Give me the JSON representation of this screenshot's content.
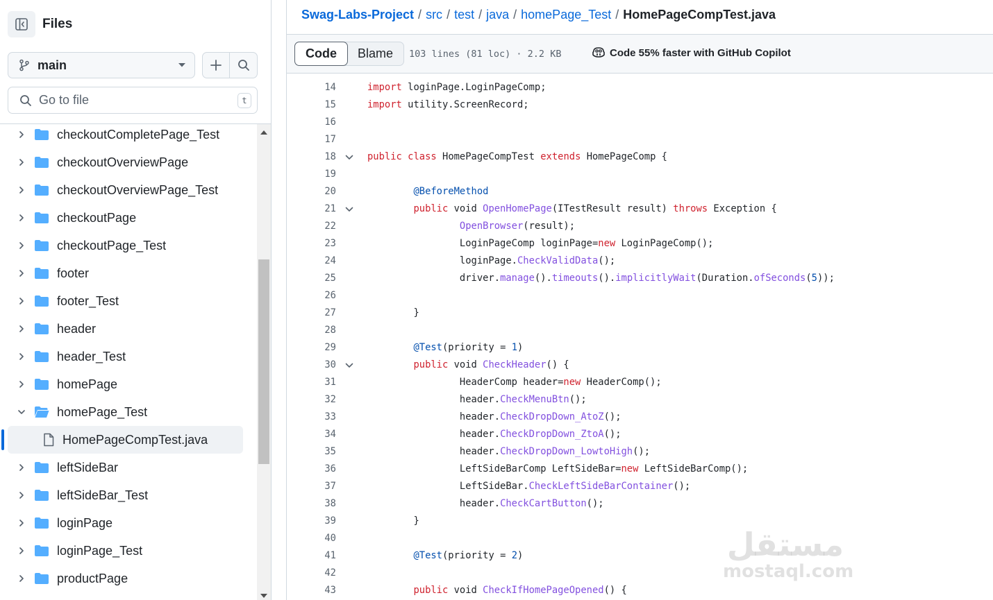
{
  "sidebar": {
    "title": "Files",
    "branch": "main",
    "goto_placeholder": "Go to file",
    "goto_shortcut": "t",
    "tree": [
      {
        "name": "checkoutCompletePage_Test",
        "type": "folder",
        "expanded": false
      },
      {
        "name": "checkoutOverviewPage",
        "type": "folder",
        "expanded": false
      },
      {
        "name": "checkoutOverviewPage_Test",
        "type": "folder",
        "expanded": false
      },
      {
        "name": "checkoutPage",
        "type": "folder",
        "expanded": false
      },
      {
        "name": "checkoutPage_Test",
        "type": "folder",
        "expanded": false
      },
      {
        "name": "footer",
        "type": "folder",
        "expanded": false
      },
      {
        "name": "footer_Test",
        "type": "folder",
        "expanded": false
      },
      {
        "name": "header",
        "type": "folder",
        "expanded": false
      },
      {
        "name": "header_Test",
        "type": "folder",
        "expanded": false
      },
      {
        "name": "homePage",
        "type": "folder",
        "expanded": false
      },
      {
        "name": "homePage_Test",
        "type": "folder",
        "expanded": true
      },
      {
        "name": "HomePageCompTest.java",
        "type": "file",
        "selected": true
      },
      {
        "name": "leftSideBar",
        "type": "folder",
        "expanded": false
      },
      {
        "name": "leftSideBar_Test",
        "type": "folder",
        "expanded": false
      },
      {
        "name": "loginPage",
        "type": "folder",
        "expanded": false
      },
      {
        "name": "loginPage_Test",
        "type": "folder",
        "expanded": false
      },
      {
        "name": "productPage",
        "type": "folder",
        "expanded": false
      }
    ]
  },
  "breadcrumb": {
    "repo": "Swag-Labs-Project",
    "parts": [
      "src",
      "test",
      "java",
      "homePage_Test"
    ],
    "current": "HomePageCompTest.java"
  },
  "toolbar": {
    "code_tab": "Code",
    "blame_tab": "Blame",
    "file_info": "103 lines (81 loc) · 2.2 KB",
    "copilot_text": "Code 55% faster with GitHub Copilot"
  },
  "code": [
    {
      "n": "14",
      "segs": [
        [
          "kw",
          "import"
        ],
        [
          "",
          "loginPage.LoginPageComp;"
        ]
      ]
    },
    {
      "n": "15",
      "segs": [
        [
          "kw",
          "import"
        ],
        [
          "",
          "utility.ScreenRecord;"
        ]
      ]
    },
    {
      "n": "16",
      "segs": []
    },
    {
      "n": "17",
      "segs": []
    },
    {
      "n": "18",
      "fold": true,
      "segs": [
        [
          "kw",
          "public"
        ],
        [
          "",
          " "
        ],
        [
          "kw",
          "class"
        ],
        [
          "",
          " HomePageCompTest "
        ],
        [
          "kw",
          "extends"
        ],
        [
          "",
          " HomePageComp {"
        ]
      ]
    },
    {
      "n": "19",
      "segs": []
    },
    {
      "n": "20",
      "segs": [
        [
          "",
          "\t"
        ],
        [
          "an",
          "@BeforeMethod"
        ]
      ]
    },
    {
      "n": "21",
      "fold": true,
      "segs": [
        [
          "",
          "\t"
        ],
        [
          "kw",
          "public"
        ],
        [
          "",
          " void "
        ],
        [
          "fn",
          "OpenHomePage"
        ],
        [
          "",
          "(ITestResult result) "
        ],
        [
          "kw",
          "throws"
        ],
        [
          "",
          " Exception {"
        ]
      ]
    },
    {
      "n": "22",
      "segs": [
        [
          "",
          "\t\t"
        ],
        [
          "fn",
          "OpenBrowser"
        ],
        [
          "",
          "(result);"
        ]
      ]
    },
    {
      "n": "23",
      "segs": [
        [
          "",
          "\t\tLoginPageComp loginPage="
        ],
        [
          "kw",
          "new"
        ],
        [
          "",
          " LoginPageComp();"
        ]
      ]
    },
    {
      "n": "24",
      "segs": [
        [
          "",
          "\t\tloginPage."
        ],
        [
          "fn",
          "CheckValidData"
        ],
        [
          "",
          "();"
        ]
      ]
    },
    {
      "n": "25",
      "segs": [
        [
          "",
          "\t\tdriver."
        ],
        [
          "fn",
          "manage"
        ],
        [
          "",
          "()."
        ],
        [
          "fn",
          "timeouts"
        ],
        [
          "",
          "()."
        ],
        [
          "fn",
          "implicitlyWait"
        ],
        [
          "",
          "(Duration."
        ],
        [
          "fn",
          "ofSeconds"
        ],
        [
          "",
          "("
        ],
        [
          "an",
          "5"
        ],
        [
          "",
          "));"
        ]
      ]
    },
    {
      "n": "26",
      "segs": []
    },
    {
      "n": "27",
      "segs": [
        [
          "",
          "\t}"
        ]
      ]
    },
    {
      "n": "28",
      "segs": []
    },
    {
      "n": "29",
      "segs": [
        [
          "",
          "\t"
        ],
        [
          "an",
          "@Test"
        ],
        [
          "",
          "(priority = "
        ],
        [
          "an",
          "1"
        ],
        [
          "",
          ")"
        ]
      ]
    },
    {
      "n": "30",
      "fold": true,
      "segs": [
        [
          "",
          "\t"
        ],
        [
          "kw",
          "public"
        ],
        [
          "",
          " void "
        ],
        [
          "fn",
          "CheckHeader"
        ],
        [
          "",
          "() {"
        ]
      ]
    },
    {
      "n": "31",
      "segs": [
        [
          "",
          "\t\tHeaderComp header="
        ],
        [
          "kw",
          "new"
        ],
        [
          "",
          " HeaderComp();"
        ]
      ]
    },
    {
      "n": "32",
      "segs": [
        [
          "",
          "\t\theader."
        ],
        [
          "fn",
          "CheckMenuBtn"
        ],
        [
          "",
          "();"
        ]
      ]
    },
    {
      "n": "33",
      "segs": [
        [
          "",
          "\t\theader."
        ],
        [
          "fn",
          "CheckDropDown_AtoZ"
        ],
        [
          "",
          "();"
        ]
      ]
    },
    {
      "n": "34",
      "segs": [
        [
          "",
          "\t\theader."
        ],
        [
          "fn",
          "CheckDropDown_ZtoA"
        ],
        [
          "",
          "();"
        ]
      ]
    },
    {
      "n": "35",
      "segs": [
        [
          "",
          "\t\theader."
        ],
        [
          "fn",
          "CheckDropDown_LowtoHigh"
        ],
        [
          "",
          "();"
        ]
      ]
    },
    {
      "n": "36",
      "segs": [
        [
          "",
          "\t\tLeftSideBarComp LeftSideBar="
        ],
        [
          "kw",
          "new"
        ],
        [
          "",
          " LeftSideBarComp();"
        ]
      ]
    },
    {
      "n": "37",
      "segs": [
        [
          "",
          "\t\tLeftSideBar."
        ],
        [
          "fn",
          "CheckLeftSideBarContainer"
        ],
        [
          "",
          "();"
        ]
      ]
    },
    {
      "n": "38",
      "segs": [
        [
          "",
          "\t\theader."
        ],
        [
          "fn",
          "CheckCartButton"
        ],
        [
          "",
          "();"
        ]
      ]
    },
    {
      "n": "39",
      "segs": [
        [
          "",
          "\t}"
        ]
      ]
    },
    {
      "n": "40",
      "segs": []
    },
    {
      "n": "41",
      "segs": [
        [
          "",
          "\t"
        ],
        [
          "an",
          "@Test"
        ],
        [
          "",
          "(priority = "
        ],
        [
          "an",
          "2"
        ],
        [
          "",
          ")"
        ]
      ]
    },
    {
      "n": "42",
      "segs": []
    },
    {
      "n": "43",
      "segs": [
        [
          "",
          "\t"
        ],
        [
          "kw",
          "public"
        ],
        [
          "",
          " void "
        ],
        [
          "fn",
          "CheckIfHomePageOpened"
        ],
        [
          "",
          "() {"
        ]
      ]
    }
  ],
  "watermark": {
    "arabic": "مستقل",
    "latin": "mostaql.com"
  },
  "colors": {
    "accent": "#0969da",
    "folder": "#54aeff",
    "keyword": "#cf222e",
    "function": "#8250df",
    "constant": "#0550ae"
  }
}
